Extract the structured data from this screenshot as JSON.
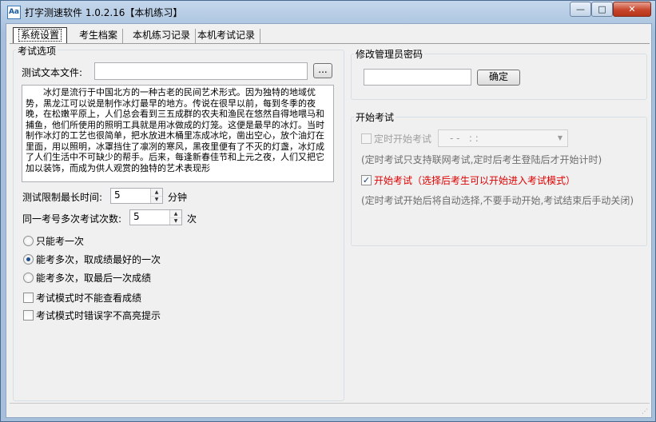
{
  "window": {
    "title": "打字测速软件  1.0.2.16【本机练习】",
    "app_icon_text": "Aa",
    "minimize": "—",
    "maximize": "□",
    "close": "✕"
  },
  "tabs": [
    {
      "label": "系统设置"
    },
    {
      "label": "考生档案"
    },
    {
      "label": "本机练习记录"
    },
    {
      "label": "本机考试记录"
    }
  ],
  "exam_options": {
    "legend": "考试选项",
    "text_file_label": "测试文本文件:",
    "text_file_value": "",
    "browse_label": "...",
    "sample_text": "冰灯是流行于中国北方的一种古老的民间艺术形式。因为独特的地域优势，黑龙江可以说是制作冰灯最早的地方。传说在很早以前，每到冬季的夜晚，在松嫩平原上，人们总会看到三五成群的农夫和渔民在悠然自得地喂马和捕鱼，他们所使用的照明工具就是用冰做成的灯笼。这便是最早的冰灯。当时制作冰灯的工艺也很简单，把水放进木桶里冻成冰坨，凿出空心，放个油灯在里面，用以照明，冰罩挡住了凛冽的寒风，黑夜里便有了不灭的灯盏，冰灯成了人们生活中不可缺少的帮手。后来，每逢新春佳节和上元之夜，人们又把它加以装饰，而成为供人观赏的独特的艺术表现形",
    "time_limit_label": "测试限制最长时间:",
    "time_limit_value": "5",
    "time_limit_unit": "分钟",
    "attempts_label": "同一考号多次考试次数:",
    "attempts_value": "5",
    "attempts_unit": "次",
    "radio_once": "只能考一次",
    "radio_best": "能考多次，取成绩最好的一次",
    "radio_last": "能考多次，取最后一次成绩",
    "check_no_score": "考试模式时不能查看成绩",
    "check_no_highlight": "考试模式时错误字不高亮提示"
  },
  "admin_password": {
    "legend": "修改管理员密码",
    "input_value": "",
    "confirm_label": "确定"
  },
  "start_exam": {
    "legend": "开始考试",
    "timed_label": "定时开始考试",
    "timed_combo_value": "- -   : :",
    "timed_hint": "(定时考试只支持联网考试,定时后考生登陆后才开始计时)",
    "start_label": "开始考试（选择后考生可以开始进入考试模式）",
    "start_hint": "(定时考试开始后将自动选择,不要手动开始,考试结束后手动关闭)"
  },
  "colors": {
    "highlight_red": "#e00000",
    "title_gradient": "#a6c0dc"
  }
}
